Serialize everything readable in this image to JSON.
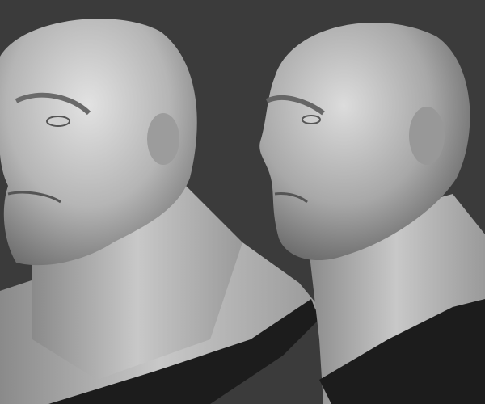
{
  "colors": {
    "background": "#3b3b3b",
    "skin_light": "#d9d9d9",
    "skin_mid": "#a9a9a9",
    "skin_dark": "#5e5e5e",
    "cloth": "#1c1c1c"
  },
  "icons": [
    "sculpt-head-front-three-quarter",
    "sculpt-head-profile"
  ]
}
